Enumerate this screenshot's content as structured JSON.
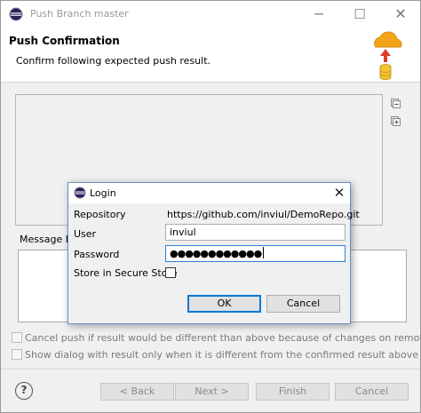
{
  "main": {
    "title": "Push Branch master",
    "banner_title": "Push Confirmation",
    "banner_desc": "Confirm following expected push result.",
    "message_label": "Message De",
    "options": [
      "Cancel push if result would be different than above because of changes on remote",
      "Show dialog with result only when it is different from the confirmed result above"
    ],
    "buttons": {
      "help": "?",
      "back": "< Back",
      "next": "Next >",
      "finish": "Finish",
      "cancel": "Cancel"
    }
  },
  "login": {
    "title": "Login",
    "repository_label": "Repository",
    "repository_value": "https://github.com/inviul/DemoRepo.git",
    "user_label": "User",
    "user_value": "inviul",
    "password_label": "Password",
    "password_value": "●●●●●●●●●●●●",
    "store_label": "Store in Secure Store",
    "store_checked": false,
    "ok_label": "OK",
    "cancel_label": "Cancel"
  },
  "icons": {
    "window_icon": "eclipse-icon",
    "banner_icon": "cloud-upload-database-icon",
    "close": "close-icon",
    "minimize": "minimize-icon",
    "maximize": "maximize-icon",
    "collapse": "collapse-all-icon",
    "expand": "expand-all-icon",
    "help": "help-icon"
  },
  "colors": {
    "focus_blue": "#0078d7",
    "cloud_orange": "#f4a418",
    "arrow_red": "#e03a2a",
    "db_yellow": "#f2c230"
  }
}
